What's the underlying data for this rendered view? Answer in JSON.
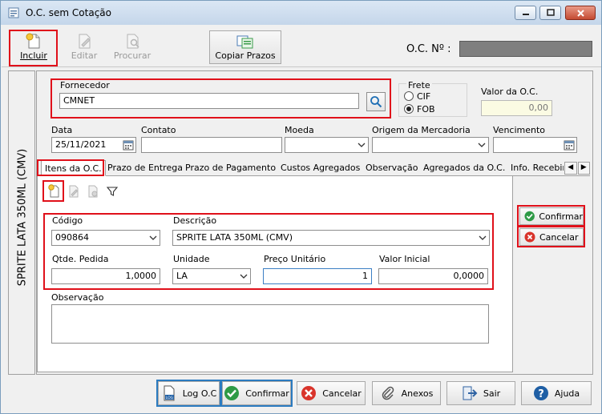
{
  "window": {
    "title": "O.C. sem Cotação",
    "minimize": "minimize-icon",
    "maximize": "maximize-icon",
    "close": "close-icon"
  },
  "toolbar": {
    "incluir": "Incluir",
    "editar": "Editar",
    "procurar": "Procurar",
    "copiar_prazos": "Copiar Prazos",
    "oc_numero_label": "O.C. Nº :"
  },
  "side_product": "SPRITE LATA 350ML (CMV)",
  "header": {
    "fornecedor_label": "Fornecedor",
    "fornecedor_value": "CMNET",
    "frete_label": "Frete",
    "frete_options": [
      "CIF",
      "FOB"
    ],
    "frete_selected": "FOB",
    "valor_oc_label": "Valor da O.C.",
    "valor_oc_value": "0,00",
    "data_label": "Data",
    "data_value": "25/11/2021",
    "contato_label": "Contato",
    "contato_value": "",
    "moeda_label": "Moeda",
    "moeda_value": "",
    "origem_label": "Origem da Mercadoria",
    "origem_value": "",
    "vencimento_label": "Vencimento",
    "vencimento_value": ""
  },
  "tabs": [
    "Itens da O.C.",
    "Prazo de Entrega",
    "Prazo de Pagamento",
    "Custos Agregados",
    "Observação",
    "Agregados da O.C.",
    "Info. Recebim"
  ],
  "item": {
    "codigo_label": "Código",
    "codigo_value": "090864",
    "descricao_label": "Descrição",
    "descricao_value": "SPRITE LATA 350ML (CMV)",
    "qtde_label": "Qtde. Pedida",
    "qtde_value": "1,0000",
    "unidade_label": "Unidade",
    "unidade_value": "LA",
    "preco_label": "Preço Unitário",
    "preco_value": "1",
    "valor_inicial_label": "Valor Inicial",
    "valor_inicial_value": "0,0000",
    "observacao_label": "Observação",
    "observacao_value": ""
  },
  "item_actions": {
    "confirmar": "Confirmar",
    "cancelar": "Cancelar"
  },
  "bottom": {
    "log": "Log O.C",
    "confirmar": "Confirmar",
    "cancelar": "Cancelar",
    "anexos": "Anexos",
    "sair": "Sair",
    "ajuda": "Ajuda"
  },
  "colors": {
    "highlight_red": "#e0101a",
    "highlight_blue": "#2b7bc0",
    "confirm_green": "#2e9a46",
    "cancel_red": "#d9342b"
  }
}
